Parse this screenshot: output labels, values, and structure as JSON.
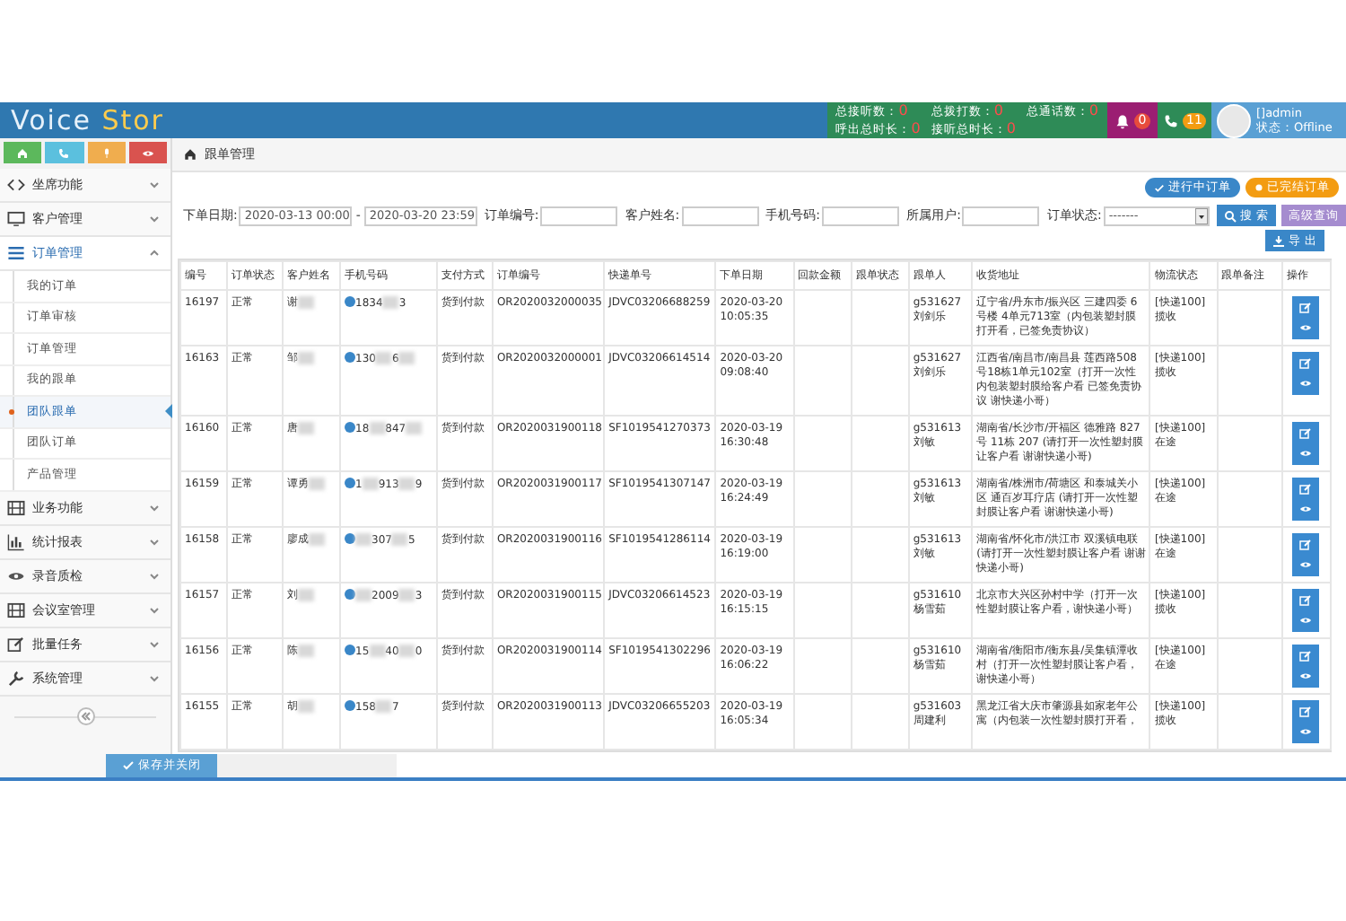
{
  "header": {
    "logo_main": "Voice ",
    "logo_accent": "Stor",
    "stats": [
      {
        "label": "总接听数：",
        "value": "0"
      },
      {
        "label": "总拨打数：",
        "value": "0"
      },
      {
        "label": "总通话数：",
        "value": "0"
      },
      {
        "label": "呼出总时长：",
        "value": "0"
      },
      {
        "label": "接听总时长：",
        "value": "0"
      }
    ],
    "bell_count": "0",
    "phone_count": "11",
    "user_name": "[]admin",
    "user_status": "状态：Offline"
  },
  "quick_buttons": [
    {
      "kind": "home",
      "color": "#5cb85c"
    },
    {
      "kind": "phone",
      "color": "#5bc0de"
    },
    {
      "kind": "mic",
      "color": "#f0ad4e"
    },
    {
      "kind": "eye",
      "color": "#d9534f"
    }
  ],
  "nav": [
    {
      "label": "坐席功能",
      "expanded": false
    },
    {
      "label": "客户管理",
      "expanded": false
    },
    {
      "label": "订单管理",
      "expanded": true,
      "children": [
        {
          "label": "我的订单",
          "selected": false
        },
        {
          "label": "订单审核",
          "selected": false
        },
        {
          "label": "订单管理",
          "selected": false
        },
        {
          "label": "我的跟单",
          "selected": false
        },
        {
          "label": "团队跟单",
          "selected": true
        },
        {
          "label": "团队订单",
          "selected": false
        },
        {
          "label": "产品管理",
          "selected": false
        }
      ]
    },
    {
      "label": "业务功能",
      "expanded": false
    },
    {
      "label": "统计报表",
      "expanded": false
    },
    {
      "label": "录音质检",
      "expanded": false
    },
    {
      "label": "会议室管理",
      "expanded": false
    },
    {
      "label": "批量任务",
      "expanded": false
    },
    {
      "label": "系统管理",
      "expanded": false
    }
  ],
  "breadcrumb": "跟单管理",
  "order_tabs": [
    {
      "label": "进行中订单",
      "kind": "active",
      "color": "#3a87c8"
    },
    {
      "label": "已完结订单",
      "kind": "done",
      "color": "#f39c12"
    }
  ],
  "filters": [
    {
      "kind": "daterange",
      "label": "下单日期:",
      "value": "2020-03-13 00:00",
      "separator": "-",
      "value_end": "2020-03-20 23:59"
    },
    {
      "kind": "text",
      "label": "订单编号:"
    },
    {
      "kind": "text",
      "label": "客户姓名:"
    },
    {
      "kind": "text",
      "label": "手机号码:"
    },
    {
      "kind": "text",
      "label": "所属用户:"
    },
    {
      "kind": "select",
      "label": "订单状态:",
      "value": "-------"
    }
  ],
  "search_button": "搜 索",
  "advanced_button": "高级查询",
  "export_button": "导 出",
  "table": {
    "columns": [
      "编号",
      "订单状态",
      "客户姓名",
      "手机号码",
      "支付方式",
      "订单编号",
      "快递单号",
      "下单日期",
      "回款金额",
      "跟单状态",
      "跟单人",
      "收货地址",
      "物流状态",
      "跟单备注",
      "操作"
    ],
    "rows": [
      {
        "id": "16197",
        "status": "正常",
        "name": "谢",
        "phone": [
          {
            "kind": "text",
            "text": "1834"
          },
          {
            "kind": "blur"
          },
          {
            "kind": "text",
            "text": "3"
          }
        ],
        "payment": "货到付款",
        "order_no": "OR2020032000035",
        "tracking": "JDVC03206688259",
        "date": "2020-03-20",
        "time": "10:05:35",
        "owner_id": "g531627",
        "owner": "刘剑乐",
        "address": "辽宁省/丹东市/振兴区 三建四委 6 号楼 4单元713室（内包装塑封膜打开看，已签免责协议）",
        "logistics": "[快递100]揽收"
      },
      {
        "id": "16163",
        "status": "正常",
        "name": "邹",
        "phone": [
          {
            "kind": "text",
            "text": "130"
          },
          {
            "kind": "blur"
          },
          {
            "kind": "text",
            "text": "6"
          },
          {
            "kind": "blur"
          }
        ],
        "payment": "货到付款",
        "order_no": "OR2020032000001",
        "tracking": "JDVC03206614514",
        "date": "2020-03-20",
        "time": "09:08:40",
        "owner_id": "g531627",
        "owner": "刘剑乐",
        "address": "江西省/南昌市/南昌县 莲西路508号18栋1单元102室（打开一次性内包装塑封膜给客户看 已签免责协议 谢快递小哥）",
        "logistics": "[快递100]揽收"
      },
      {
        "id": "16160",
        "status": "正常",
        "name": "唐",
        "phone": [
          {
            "kind": "text",
            "text": "18"
          },
          {
            "kind": "blur"
          },
          {
            "kind": "text",
            "text": "847"
          },
          {
            "kind": "blur"
          }
        ],
        "payment": "货到付款",
        "order_no": "OR2020031900118",
        "tracking": "SF1019541270373",
        "date": "2020-03-19",
        "time": "16:30:48",
        "owner_id": "g531613",
        "owner": "刘敏",
        "address": "湖南省/长沙市/开福区 德雅路 827 号 11栋 207 (请打开一次性塑封膜让客户看 谢谢快递小哥)",
        "logistics": "[快递100]在途"
      },
      {
        "id": "16159",
        "status": "正常",
        "name": "谭勇",
        "phone": [
          {
            "kind": "text",
            "text": "1"
          },
          {
            "kind": "blur"
          },
          {
            "kind": "text",
            "text": "913"
          },
          {
            "kind": "blur"
          },
          {
            "kind": "text",
            "text": "9"
          }
        ],
        "payment": "货到付款",
        "order_no": "OR2020031900117",
        "tracking": "SF1019541307147",
        "date": "2020-03-19",
        "time": "16:24:49",
        "owner_id": "g531613",
        "owner": "刘敏",
        "address": "湖南省/株洲市/荷塘区 和泰城关小区 通百岁耳疗店 (请打开一次性塑封膜让客户看 谢谢快递小哥)",
        "logistics": "[快递100]在途"
      },
      {
        "id": "16158",
        "status": "正常",
        "name": "廖成",
        "phone": [
          {
            "kind": "blur"
          },
          {
            "kind": "text",
            "text": "307"
          },
          {
            "kind": "blur"
          },
          {
            "kind": "text",
            "text": "5"
          }
        ],
        "payment": "货到付款",
        "order_no": "OR2020031900116",
        "tracking": "SF1019541286114",
        "date": "2020-03-19",
        "time": "16:19:00",
        "owner_id": "g531613",
        "owner": "刘敏",
        "address": "湖南省/怀化市/洪江市 双溪镇电联(请打开一次性塑封膜让客户看 谢谢快递小哥)",
        "logistics": "[快递100]在途"
      },
      {
        "id": "16157",
        "status": "正常",
        "name": "刘",
        "phone": [
          {
            "kind": "blur"
          },
          {
            "kind": "text",
            "text": "2009"
          },
          {
            "kind": "blur"
          },
          {
            "kind": "text",
            "text": "3"
          }
        ],
        "payment": "货到付款",
        "order_no": "OR2020031900115",
        "tracking": "JDVC03206614523",
        "date": "2020-03-19",
        "time": "16:15:15",
        "owner_id": "g531610",
        "owner": "杨雪茹",
        "address": "北京市大兴区孙村中学（打开一次性塑封膜让客户看，谢快递小哥）",
        "logistics": "[快递100]揽收"
      },
      {
        "id": "16156",
        "status": "正常",
        "name": "陈",
        "phone": [
          {
            "kind": "text",
            "text": "15"
          },
          {
            "kind": "blur"
          },
          {
            "kind": "text",
            "text": "40"
          },
          {
            "kind": "blur"
          },
          {
            "kind": "text",
            "text": "0"
          }
        ],
        "payment": "货到付款",
        "order_no": "OR2020031900114",
        "tracking": "SF1019541302296",
        "date": "2020-03-19",
        "time": "16:06:22",
        "owner_id": "g531610",
        "owner": "杨雪茹",
        "address": "湖南省/衡阳市/衡东县/吴集镇潭收村（打开一次性塑封膜让客户看，谢快递小哥）",
        "logistics": "[快递100]在途"
      },
      {
        "id": "16155",
        "status": "正常",
        "name": "胡",
        "phone": [
          {
            "kind": "text",
            "text": "158"
          },
          {
            "kind": "blur"
          },
          {
            "kind": "text",
            "text": "7"
          }
        ],
        "payment": "货到付款",
        "order_no": "OR2020031900113",
        "tracking": "JDVC03206655203",
        "date": "2020-03-19",
        "time": "16:05:34",
        "owner_id": "g531603",
        "owner": "周建利",
        "address": "黑龙江省大庆市肇源县如家老年公寓（内包装一次性塑封膜打开看，",
        "logistics": "[快递100]揽收"
      }
    ]
  },
  "footer_button": "保存并关闭"
}
